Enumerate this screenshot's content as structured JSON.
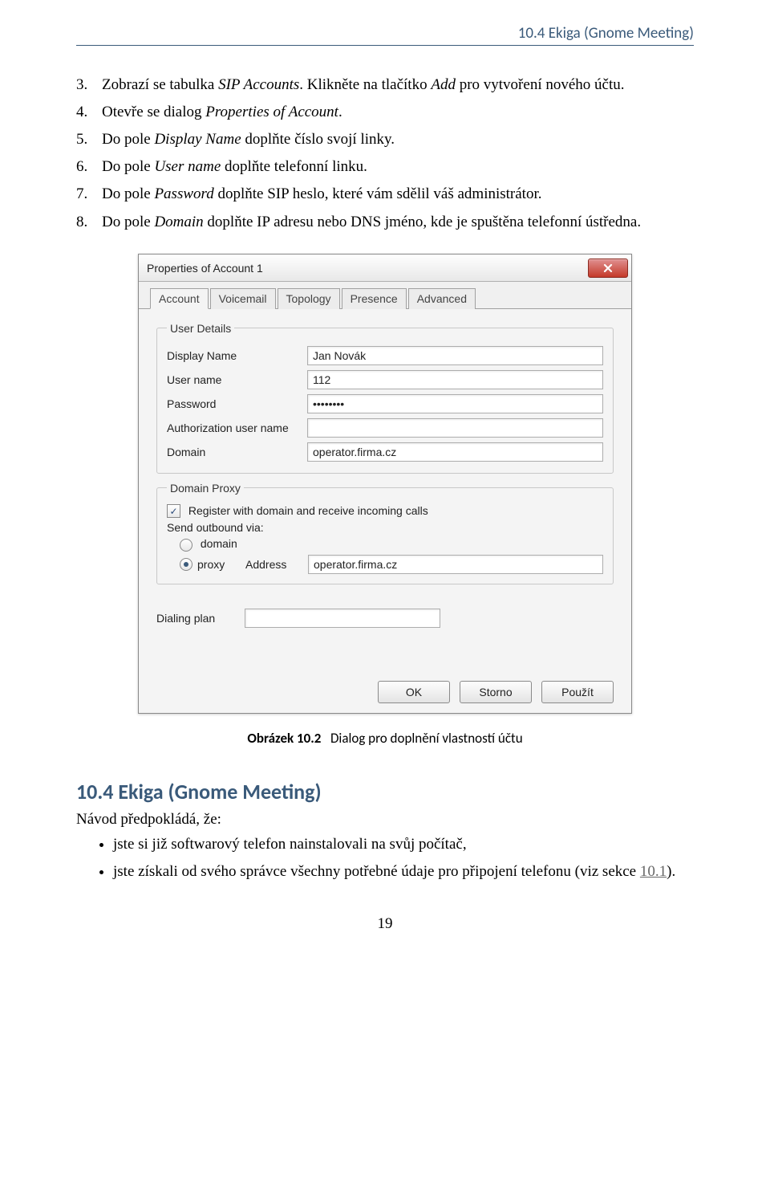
{
  "header": "10.4  Ekiga (Gnome Meeting)",
  "steps": [
    {
      "n": "3.",
      "t": "Zobrazí se tabulka <span class='italic'>SIP Accounts</span>. Klikněte na tlačítko <span class='italic'>Add</span> pro vytvoření nového účtu."
    },
    {
      "n": "4.",
      "t": "Otevře se dialog <span class='italic'>Properties of Account</span>."
    },
    {
      "n": "5.",
      "t": "Do pole <span class='italic'>Display Name</span> doplňte číslo svojí linky."
    },
    {
      "n": "6.",
      "t": "Do pole <span class='italic'>User name</span> doplňte telefonní linku."
    },
    {
      "n": "7.",
      "t": "Do pole <span class='italic'>Password</span> doplňte SIP heslo, které vám sdělil váš administrátor."
    },
    {
      "n": "8.",
      "t": "Do pole <span class='italic'>Domain</span> doplňte IP adresu nebo DNS jméno, kde je spuštěna telefonní ústředna."
    }
  ],
  "dialog": {
    "title": "Properties of Account 1",
    "tabs": [
      "Account",
      "Voicemail",
      "Topology",
      "Presence",
      "Advanced"
    ],
    "user_details": {
      "legend": "User Details",
      "display_name_label": "Display Name",
      "display_name_value": "Jan Novák",
      "user_name_label": "User name",
      "user_name_value": "112",
      "password_label": "Password",
      "password_value": "••••••••",
      "auth_user_label": "Authorization user name",
      "auth_user_value": "",
      "domain_label": "Domain",
      "domain_value": "operator.firma.cz"
    },
    "domain_proxy": {
      "legend": "Domain Proxy",
      "register_label": "Register with domain and receive incoming calls",
      "send_label": "Send outbound via:",
      "opt_domain": "domain",
      "opt_proxy": "proxy",
      "address_label": "Address",
      "address_value": "operator.firma.cz"
    },
    "dialing_label": "Dialing plan",
    "dialing_value": "",
    "buttons": {
      "ok": "OK",
      "cancel": "Storno",
      "apply": "Použít"
    }
  },
  "caption_bold": "Obrázek 10.2",
  "caption_rest": "Dialog pro doplnění vlastností účtu",
  "section_heading": "10.4  Ekiga (Gnome Meeting)",
  "intro": "Návod předpokládá, že:",
  "bullets": [
    "jste si již softwarový telefon nainstalovali na svůj počítač,",
    "jste získali od svého správce všechny potřebné údaje pro připojení telefonu (viz sekce <span class='link'>10.1</span>)."
  ],
  "page_number": "19"
}
